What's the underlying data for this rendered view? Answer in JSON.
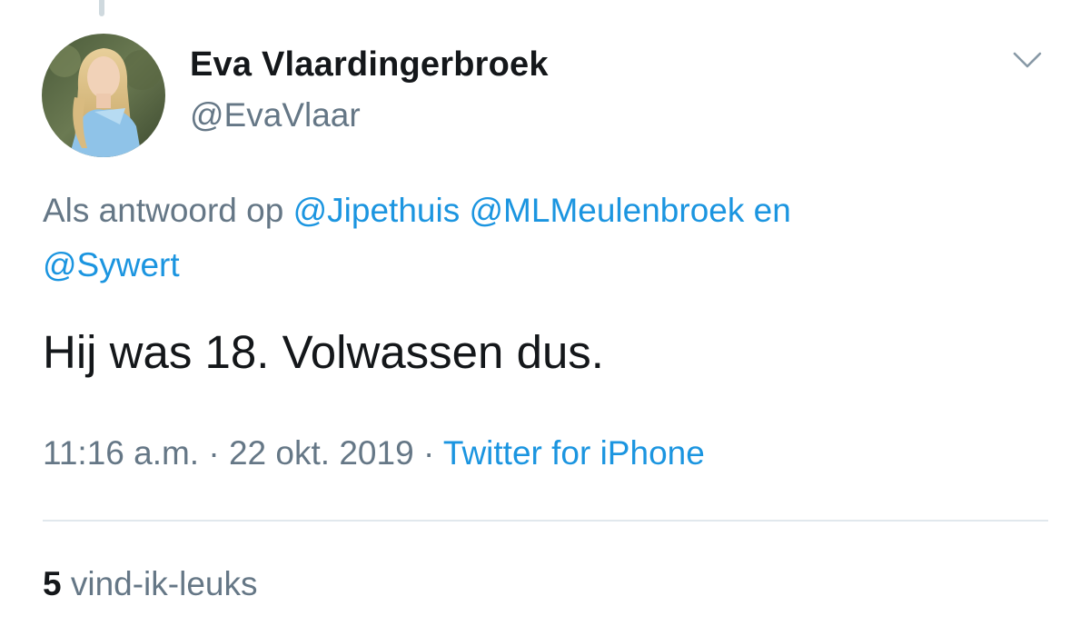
{
  "tweet": {
    "author": {
      "display_name": "Eva Vlaardingerbroek",
      "handle": "@EvaVlaar"
    },
    "reply_context": {
      "prefix": "Als antwoord op",
      "mentions": [
        "@Jipethuis",
        "@MLMeulenbroek",
        "@Sywert"
      ],
      "conjunction": "en"
    },
    "text": "Hij was 18. Volwassen dus.",
    "time": "11:16 a.m.",
    "separator": "·",
    "date": "22 okt. 2019",
    "source": "Twitter for iPhone",
    "likes": {
      "count": "5",
      "label": "vind-ik-leuks"
    },
    "menu_icon": "chevron-down-icon"
  },
  "colors": {
    "link": "#1b95e0",
    "secondary_text": "#657786",
    "primary_text": "#14171a",
    "divider": "#e1e8ed",
    "thread_line": "#cfd9de"
  }
}
